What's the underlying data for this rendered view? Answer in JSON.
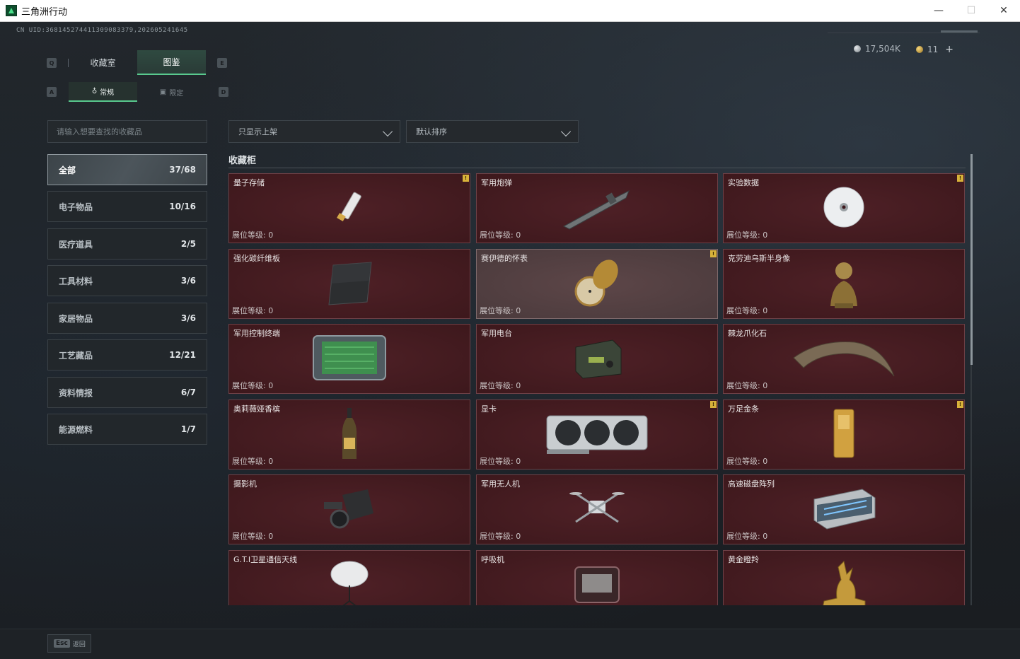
{
  "window": {
    "title": "三角洲行动",
    "minimize_glyph": "—",
    "maximize_glyph": "☐",
    "close_glyph": "✕"
  },
  "header": {
    "uid": "CN UID:368145274411309083379,202605241645",
    "currency": [
      {
        "icon": "silver-coin-icon",
        "value": "17,504K"
      },
      {
        "icon": "gold-coin-icon",
        "value": "11"
      }
    ],
    "add_glyph": "+"
  },
  "keys": {
    "q": "Q",
    "e": "E",
    "a": "A",
    "d": "D"
  },
  "tabs": [
    {
      "label": "收藏室",
      "active": false
    },
    {
      "label": "图鉴",
      "active": true
    }
  ],
  "subtabs": [
    {
      "label": "常规",
      "icon": "flask-icon",
      "icon_glyph": "♁",
      "active": true
    },
    {
      "label": "限定",
      "icon": "image-icon",
      "icon_glyph": "▣",
      "active": false
    }
  ],
  "search": {
    "placeholder": "请输入想要查找的收藏品",
    "value": ""
  },
  "filters": {
    "shelf": "只显示上架",
    "sort": "默认排序"
  },
  "categories": [
    {
      "label": "全部",
      "count": "37/68",
      "active": true
    },
    {
      "label": "电子物品",
      "count": "10/16",
      "active": false
    },
    {
      "label": "医疗道具",
      "count": "2/5",
      "active": false
    },
    {
      "label": "工具材料",
      "count": "3/6",
      "active": false
    },
    {
      "label": "家居物品",
      "count": "3/6",
      "active": false
    },
    {
      "label": "工艺藏品",
      "count": "12/21",
      "active": false
    },
    {
      "label": "资料情报",
      "count": "6/7",
      "active": false
    },
    {
      "label": "能源燃料",
      "count": "1/7",
      "active": false
    }
  ],
  "section": {
    "title": "收藏柜"
  },
  "level_label": "展位等级: 0",
  "badge_glyph": "!",
  "items": [
    {
      "name": "量子存储",
      "icon": "usb-drive-icon",
      "badge": true,
      "highlight": false
    },
    {
      "name": "军用炮弹",
      "icon": "missile-icon",
      "badge": false,
      "highlight": false
    },
    {
      "name": "实验数据",
      "icon": "disc-icon",
      "badge": true,
      "highlight": false
    },
    {
      "name": "强化碳纤维板",
      "icon": "carbon-plate-icon",
      "badge": false,
      "highlight": false
    },
    {
      "name": "赛伊德的怀表",
      "icon": "pocket-watch-icon",
      "badge": true,
      "highlight": true
    },
    {
      "name": "克劳迪乌斯半身像",
      "icon": "bust-statue-icon",
      "badge": false,
      "highlight": false
    },
    {
      "name": "军用控制终端",
      "icon": "control-terminal-icon",
      "badge": false,
      "highlight": false
    },
    {
      "name": "军用电台",
      "icon": "radio-icon",
      "badge": false,
      "highlight": false
    },
    {
      "name": "棘龙爪化石",
      "icon": "claw-fossil-icon",
      "badge": false,
      "highlight": false
    },
    {
      "name": "奥莉薇娅香槟",
      "icon": "champagne-bottle-icon",
      "badge": false,
      "highlight": false
    },
    {
      "name": "显卡",
      "icon": "graphics-card-icon",
      "badge": true,
      "highlight": false
    },
    {
      "name": "万足金条",
      "icon": "gold-bar-icon",
      "badge": true,
      "highlight": false
    },
    {
      "name": "摄影机",
      "icon": "camera-icon",
      "badge": false,
      "highlight": false
    },
    {
      "name": "军用无人机",
      "icon": "drone-icon",
      "badge": false,
      "highlight": false
    },
    {
      "name": "高速磁盘阵列",
      "icon": "disk-array-icon",
      "badge": false,
      "highlight": false
    },
    {
      "name": "G.T.I卫星通信天线",
      "icon": "satellite-dish-icon",
      "badge": false,
      "highlight": false
    },
    {
      "name": "呼吸机",
      "icon": "ventilator-icon",
      "badge": false,
      "highlight": false
    },
    {
      "name": "黄金瞪羚",
      "icon": "gold-gazelle-icon",
      "badge": false,
      "highlight": false
    }
  ],
  "footer": {
    "esc_key": "Esc",
    "back_label": "返回"
  }
}
